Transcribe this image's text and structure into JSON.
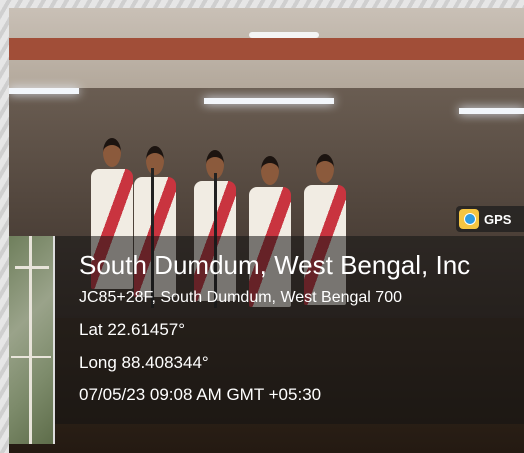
{
  "gps_badge": {
    "label": "GPS",
    "icon": "gps-map-camera-icon"
  },
  "location": {
    "title": "South Dumdum, West Bengal, Inc",
    "address": "JC85+28F, South Dumdum, West Bengal 700",
    "lat": "Lat 22.61457°",
    "long": "Long 88.408344°",
    "datetime": "07/05/23 09:08 AM GMT +05:30"
  },
  "colors": {
    "saree_border": "#c9343f",
    "overlay": "#141414"
  }
}
